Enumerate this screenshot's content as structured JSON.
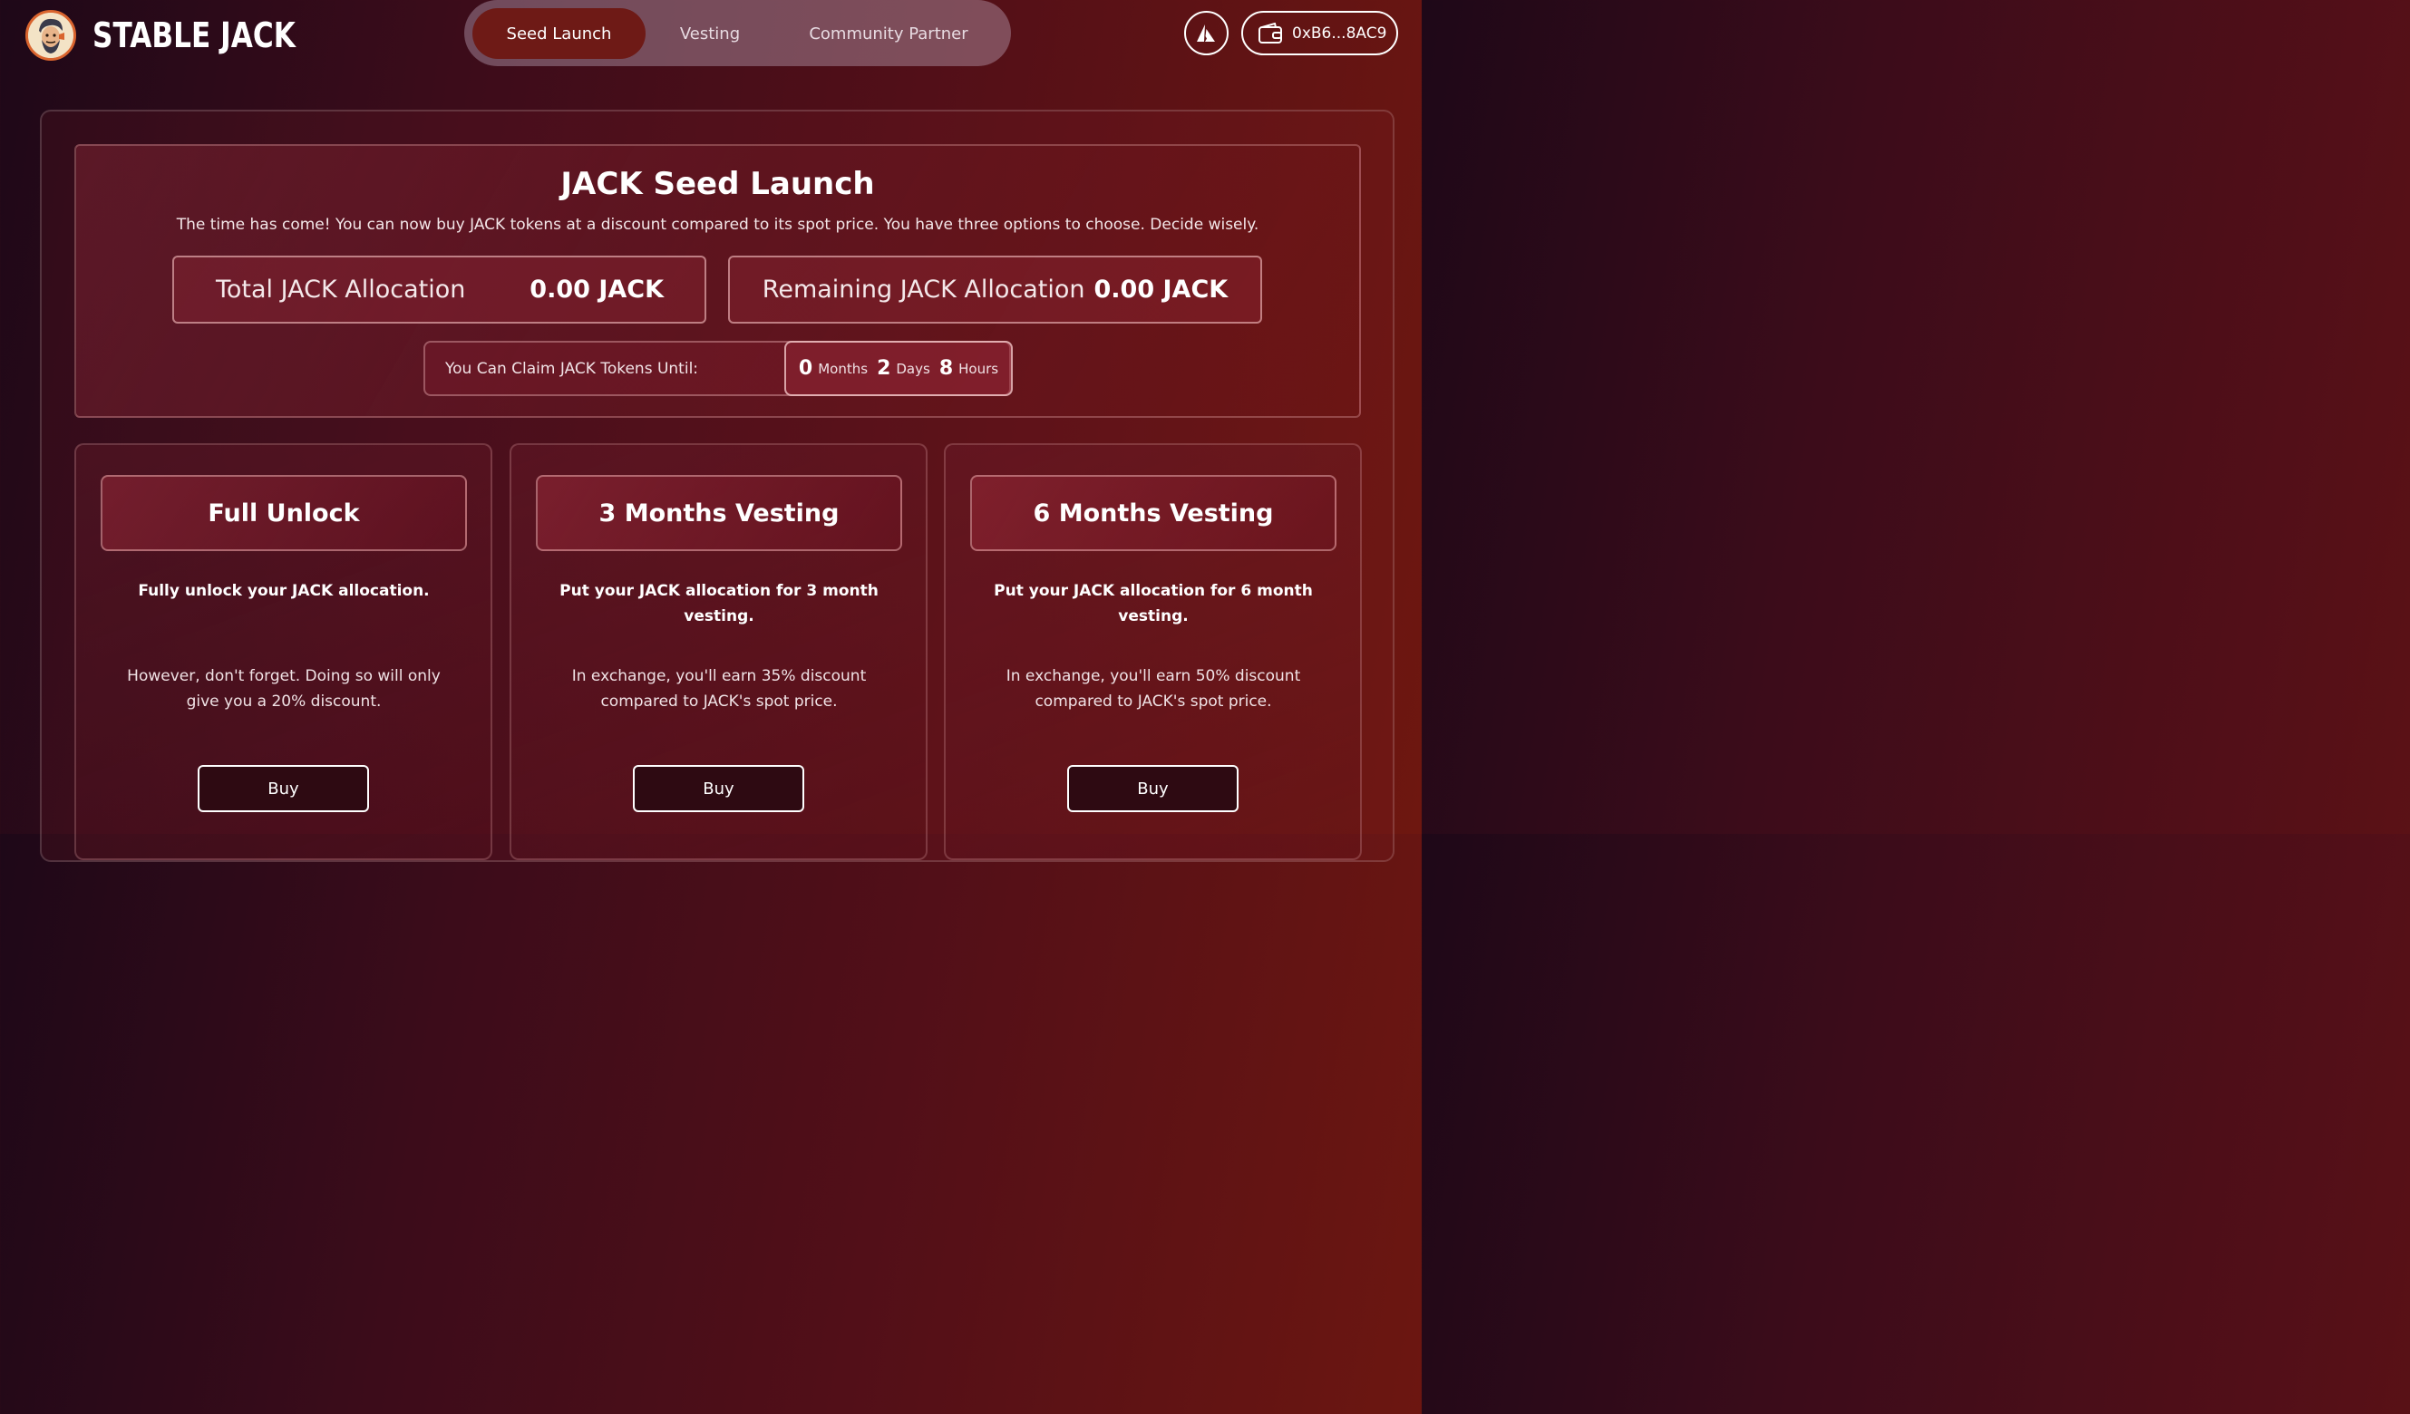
{
  "header": {
    "brand": "STABLE JACK",
    "wallet_address": "0xB6...8AC9"
  },
  "nav": {
    "tabs": [
      {
        "label": "Seed Launch",
        "active": true
      },
      {
        "label": "Vesting",
        "active": false
      },
      {
        "label": "Community Partner",
        "active": false
      }
    ]
  },
  "hero": {
    "title": "JACK Seed Launch",
    "subtitle": "The time has come! You can now buy JACK tokens at a discount compared to its spot price. You have three options to choose. Decide wisely.",
    "total_label": "Total JACK Allocation",
    "total_value": "0.00 JACK",
    "remaining_label": "Remaining JACK Allocation",
    "remaining_value": "0.00 JACK",
    "claim_label": "You Can Claim JACK Tokens Until:",
    "countdown": {
      "months": "0",
      "months_label": "Months",
      "days": "2",
      "days_label": "Days",
      "hours": "8",
      "hours_label": "Hours"
    }
  },
  "options": [
    {
      "title": "Full Unlock",
      "lead": "Fully unlock your JACK allocation.",
      "desc": "However, don't forget. Doing so will only give you a 20% discount.",
      "button": "Buy"
    },
    {
      "title": "3 Months Vesting",
      "lead": "Put your JACK allocation for 3 month vesting.",
      "desc": "In exchange, you'll earn 35% discount compared to JACK's spot price.",
      "button": "Buy"
    },
    {
      "title": "6 Months Vesting",
      "lead": "Put your JACK allocation for 6 month vesting.",
      "desc": "In exchange, you'll earn 50% discount compared to JACK's spot price.",
      "button": "Buy"
    }
  ],
  "colors": {
    "accent_tab": "#6e1a16",
    "background_start": "#1e0818",
    "background_end": "#6e1710",
    "logo_ring": "#d9642e"
  },
  "icons": {
    "network": "avalanche-icon",
    "wallet": "wallet-icon",
    "logo": "jack-mascot-logo"
  }
}
